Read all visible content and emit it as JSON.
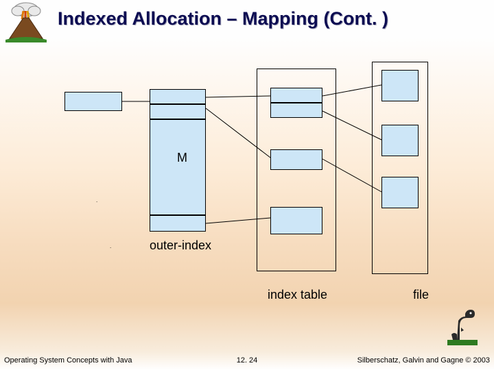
{
  "slide": {
    "title": "Indexed Allocation – Mapping (Cont. )",
    "labels": {
      "outer_index": "outer-index",
      "index_table": "index table",
      "file": "file"
    },
    "glyph": {
      "arrowish": "M"
    },
    "footer": {
      "left": "Operating System Concepts with Java",
      "center": "12. 24",
      "right": "Silberschatz, Galvin and Gagne © 2003"
    }
  }
}
